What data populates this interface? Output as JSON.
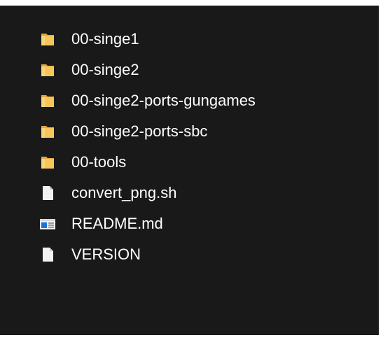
{
  "explorer": {
    "items": [
      {
        "name": "00-singe1",
        "icon": "folder-icon"
      },
      {
        "name": "00-singe2",
        "icon": "folder-icon"
      },
      {
        "name": "00-singe2-ports-gungames",
        "icon": "folder-icon"
      },
      {
        "name": "00-singe2-ports-sbc",
        "icon": "folder-icon"
      },
      {
        "name": "00-tools",
        "icon": "folder-icon"
      },
      {
        "name": "convert_png.sh",
        "icon": "file-icon"
      },
      {
        "name": "README.md",
        "icon": "markdown-file-icon"
      },
      {
        "name": "VERSION",
        "icon": "file-icon"
      }
    ]
  },
  "colors": {
    "background": "#191919",
    "text": "#ffffff",
    "folder": "#f7c65a",
    "folder_shade": "#e0a93c",
    "file": "#f2f2f2",
    "markdown_accent": "#1e73d8"
  }
}
